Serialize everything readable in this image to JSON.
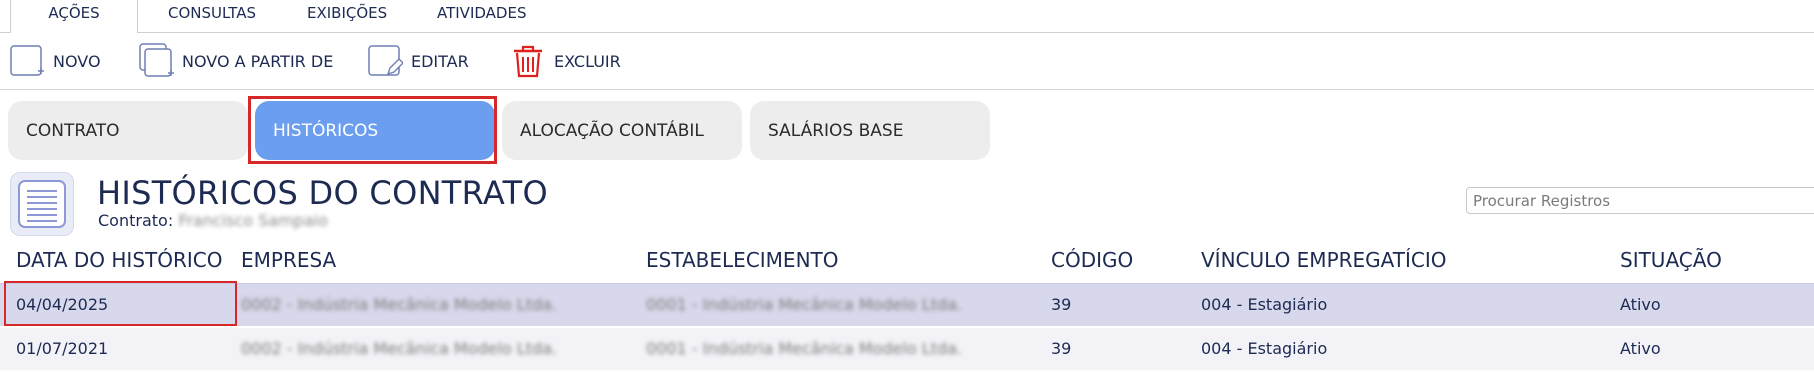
{
  "menu": {
    "tabs": [
      {
        "label": "AÇÕES",
        "active": true
      },
      {
        "label": "CONSULTAS",
        "active": false
      },
      {
        "label": "EXIBIÇÕES",
        "active": false
      },
      {
        "label": "ATIVIDADES",
        "active": false
      }
    ]
  },
  "toolbar": {
    "novo": "NOVO",
    "novo_a_partir_de": "NOVO A PARTIR DE",
    "editar": "EDITAR",
    "excluir": "EXCLUIR"
  },
  "section_tabs": [
    {
      "label": "CONTRATO",
      "active": false
    },
    {
      "label": "HISTÓRICOS",
      "active": true
    },
    {
      "label": "ALOCAÇÃO CONTÁBIL",
      "active": false
    },
    {
      "label": "SALÁRIOS BASE",
      "active": false
    }
  ],
  "header": {
    "title": "HISTÓRICOS DO CONTRATO",
    "contract_label": "Contrato:",
    "contract_name": "Francisco Sampaio"
  },
  "search": {
    "placeholder": "Procurar Registros"
  },
  "table": {
    "columns": [
      "DATA DO HISTÓRICO",
      "EMPRESA",
      "ESTABELECIMENTO",
      "CÓDIGO",
      "VÍNCULO EMPREGATÍCIO",
      "SITUAÇÃO"
    ],
    "rows": [
      {
        "data": "04/04/2025",
        "empresa": "0002 - Indústria Mecânica Modelo Ltda.",
        "estabelecimento": "0001 - Indústria Mecânica Modelo Ltda.",
        "codigo": "39",
        "vinculo": "004 - Estagiário",
        "situacao": "Ativo",
        "selected": true
      },
      {
        "data": "01/07/2021",
        "empresa": "0002 - Indústria Mecânica Modelo Ltda.",
        "estabelecimento": "0001 - Indústria Mecânica Modelo Ltda.",
        "codigo": "39",
        "vinculo": "004 - Estagiário",
        "situacao": "Ativo",
        "selected": false
      }
    ]
  },
  "colors": {
    "accent_tab": "#6c9ef0",
    "selected_row": "#d7d8eb",
    "highlight_border": "#d62828",
    "delete_icon": "#e0201e",
    "text": "#1d2a52"
  }
}
